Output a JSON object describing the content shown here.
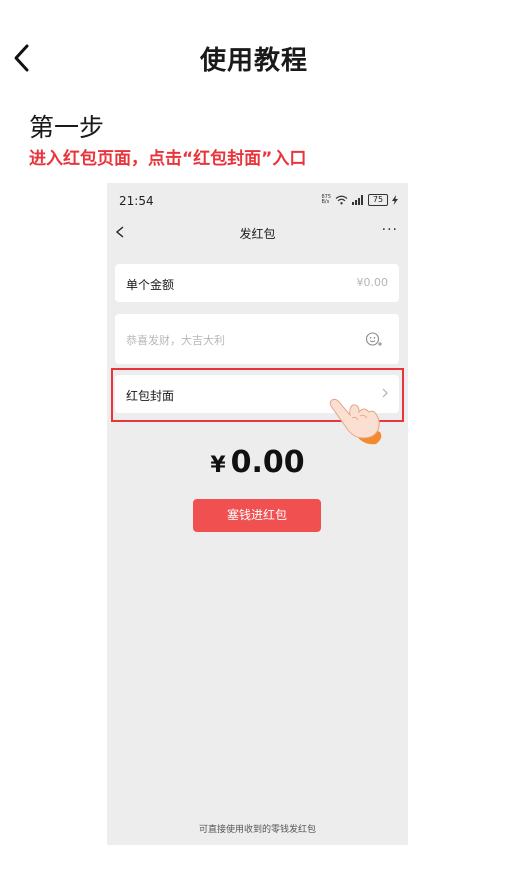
{
  "header": {
    "title": "使用教程"
  },
  "step": {
    "title": "第一步",
    "description": "进入红包页面，点击“红包封面”入口"
  },
  "phone": {
    "status_bar": {
      "time": "21:54",
      "net_speed_top": "875",
      "net_speed_bottom": "B/s",
      "battery": "75"
    },
    "title": "发红包",
    "more": "···",
    "amount_row": {
      "label": "单个金额",
      "value": "¥0.00"
    },
    "message_placeholder": "恭喜发财，大吉大利",
    "cover_row": {
      "label": "红包封面"
    },
    "amount_display": {
      "currency": "¥",
      "value": "0.00"
    },
    "send_button": "塞钱进红包",
    "footnote": "可直接使用收到的零钱发红包"
  },
  "icons": {
    "back": "back-chevron-icon",
    "more": "more-icon",
    "emoji": "emoji-icon",
    "chevron_right": "chevron-right-icon",
    "pointer": "pointing-hand-icon"
  },
  "colors": {
    "accent": "#e8343a",
    "send_button": "#f05050",
    "phone_bg": "#ededed"
  }
}
